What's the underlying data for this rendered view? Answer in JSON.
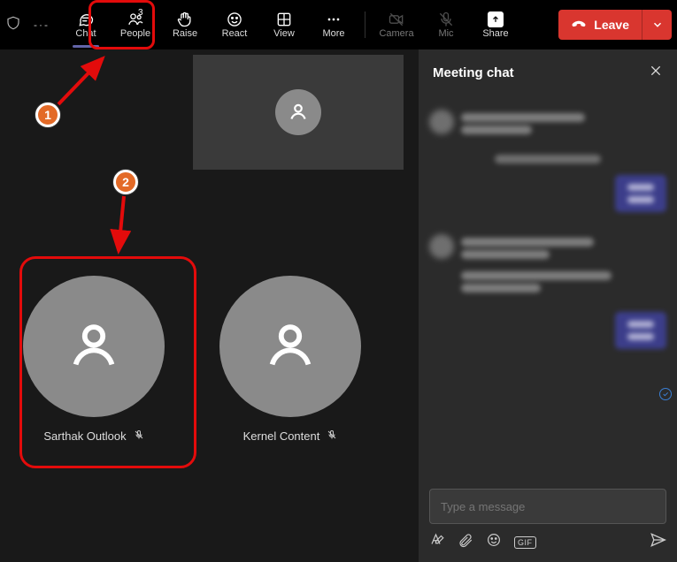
{
  "toolbar": {
    "chat": "Chat",
    "people": "People",
    "people_count": "3",
    "raise": "Raise",
    "react": "React",
    "view": "View",
    "more": "More",
    "camera": "Camera",
    "mic": "Mic",
    "share": "Share",
    "leave": "Leave"
  },
  "participants": [
    {
      "name": "Sarthak Outlook",
      "muted": true
    },
    {
      "name": "Kernel Content",
      "muted": true
    }
  ],
  "chat": {
    "title": "Meeting chat",
    "input_placeholder": "Type a message"
  },
  "annotations": {
    "one": "1",
    "two": "2"
  }
}
